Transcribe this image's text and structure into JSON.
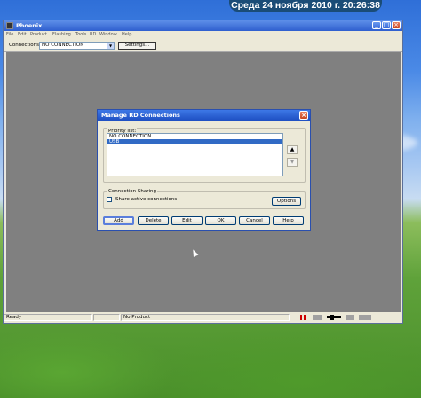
{
  "clock": "Среда  24 ноября 2010 г.  20:26:38",
  "window": {
    "title": "Phoenix",
    "menu": [
      "File",
      "Edit",
      "Product",
      "Flashing",
      "Tools",
      "RD",
      "Window",
      "Help"
    ],
    "minimize": "_",
    "maximize": "□",
    "close": "×"
  },
  "toolbar": {
    "connections_label": "Connections:",
    "connection_value": "NO CONNECTION",
    "settings_button": "Settings..."
  },
  "status": {
    "ready": "Ready",
    "product": "No Product"
  },
  "dialog": {
    "title": "Manage RD Connections",
    "close": "×",
    "priority_list_label": "Priority list:",
    "priority_items": [
      {
        "label": "NO CONNECTION",
        "selected": false
      },
      {
        "label": "USB",
        "selected": true
      }
    ],
    "up_arrow": "▲",
    "down_arrow": "▼",
    "connection_sharing_label": "Connection Sharing",
    "share_checkbox_label": "Share active connections",
    "share_checked": false,
    "options_button": "Options",
    "buttons": {
      "add": "Add",
      "delete": "Delete",
      "edit": "Edit",
      "ok": "OK",
      "cancel": "Cancel",
      "help": "Help"
    }
  }
}
